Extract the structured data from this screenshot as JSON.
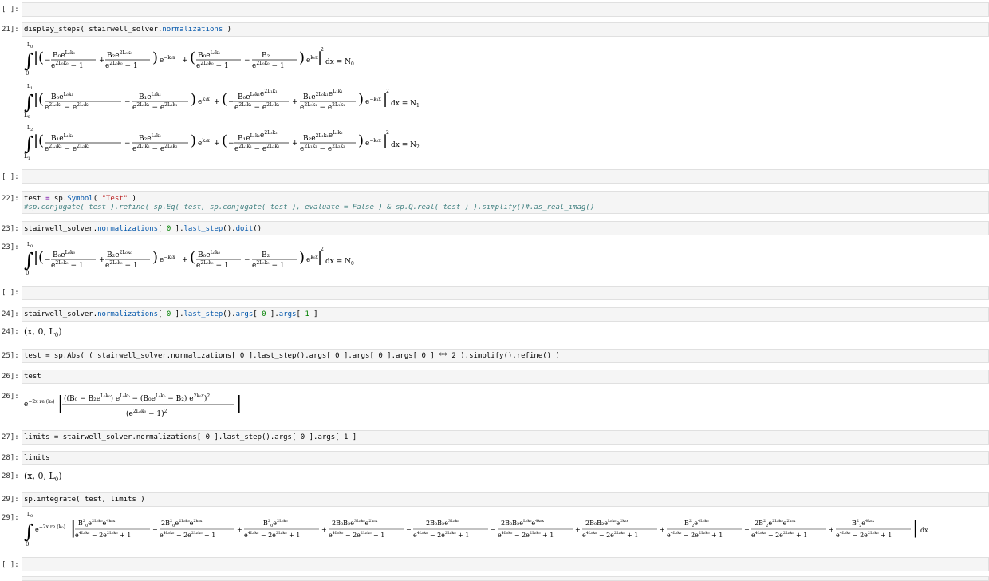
{
  "prompts": {
    "empty": "[ ]:",
    "p21": "21]:",
    "p22": "22]:",
    "p23": "23]:",
    "p24": "24]:",
    "p25": "25]:",
    "p26": "26]:",
    "p27": "27]:",
    "p28": "28]:",
    "p29": "29]:"
  },
  "cells": {
    "c21": {
      "a": "display_steps( stairwell_solver.",
      "b": "normalizations",
      "c": " )"
    },
    "c22a": {
      "a": "test ",
      "b": "=",
      "c": " sp.",
      "d": "Symbol",
      "e": "( ",
      "f": "\"Test\"",
      "g": " )"
    },
    "c22b": "#sp.conjugate( test ).refine( sp.Eq( test, sp.conjugate( test ), evaluate = False ) & sp.Q.real( test ) ).simplify()#.as_real_imag()",
    "c23": {
      "a": "stairwell_solver.",
      "b": "normalizations",
      "c": "[ ",
      "d": "0",
      "e": " ].",
      "f": "last_step",
      "g": "().",
      "h": "doit",
      "i": "()"
    },
    "c24": {
      "a": "stairwell_solver.",
      "b": "normalizations",
      "c": "[ ",
      "d": "0",
      "e": " ].",
      "f": "last_step",
      "g": "().",
      "h": "args",
      "i": "[ ",
      "j": "0",
      "k": " ].",
      "l": "args",
      "m": "[ ",
      "n": "1",
      "o": " ]"
    },
    "c25": "test = sp.Abs( ( stairwell_solver.normalizations[ 0 ].last_step().args[ 0 ].args[ 0 ].args[ 0 ] ** 2 ).simplify().refine() )",
    "c26": "test",
    "c27": "limits = stairwell_solver.normalizations[ 0 ].last_step().args[ 0 ].args[ 1 ]",
    "c28": "limits",
    "c29": "sp.integrate( test, limits )"
  },
  "outputs": {
    "o24": "(x,  0,  L",
    "o24sub": "0",
    "o28": "(x,  0,  L",
    "o28sub": "0"
  }
}
